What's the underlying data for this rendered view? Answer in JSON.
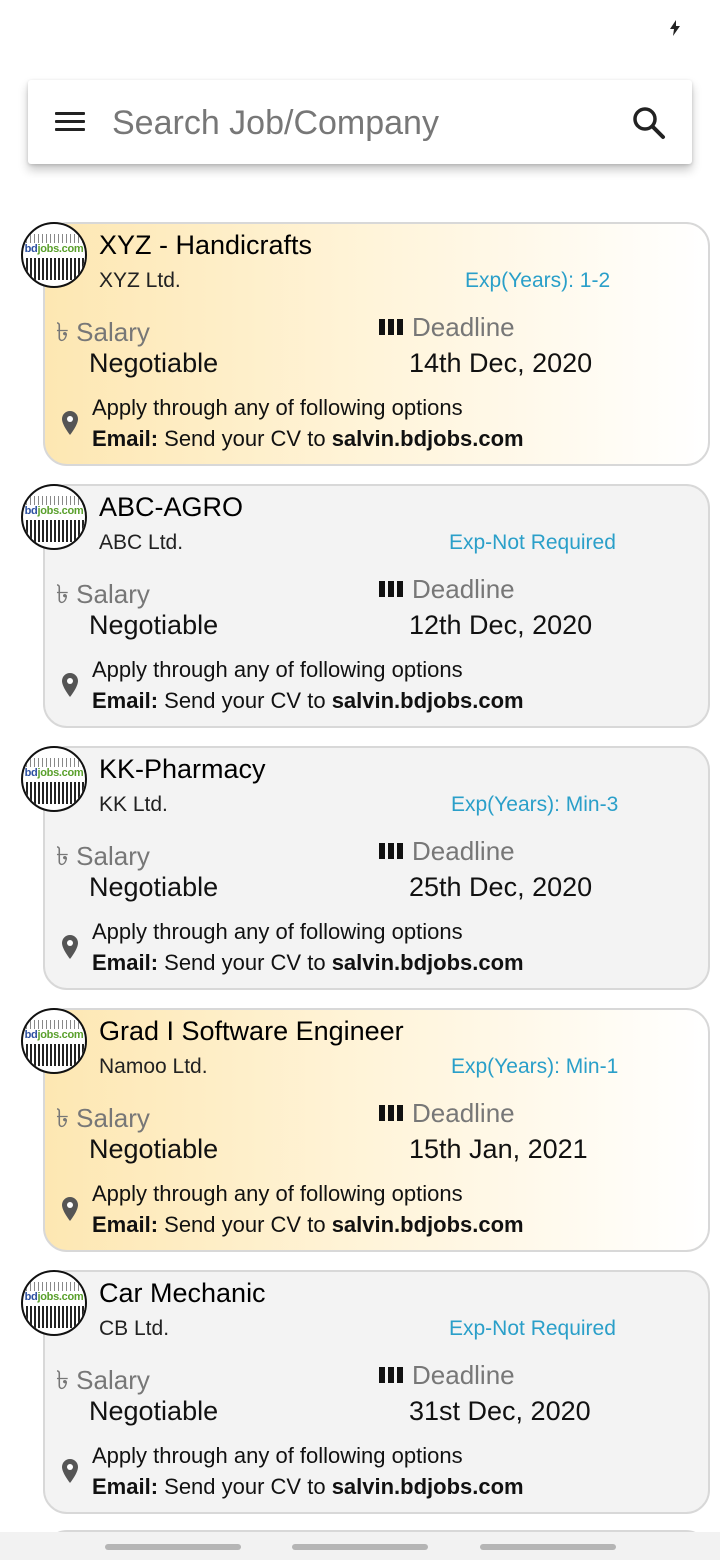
{
  "status_bar": {
    "icon": "bolt-icon"
  },
  "search": {
    "placeholder": "Search Job/Company",
    "menu_icon": "menu-icon",
    "search_icon": "search-icon"
  },
  "colors": {
    "highlight_start": "#fde7b2",
    "card_bg": "#f3f3f3",
    "exp_text": "#2a9fc9",
    "label_text": "#777777"
  },
  "common": {
    "salary_label": "৳ Salary",
    "deadline_label": "Deadline",
    "apply_text": "Apply through any of following options",
    "email_label": "Email:",
    "email_text": " Send your CV to ",
    "email_address": "salvin.bdjobs.com",
    "logo_text_a": "bd",
    "logo_text_b": "jobs.com"
  },
  "jobs": [
    {
      "title": "XYZ - Handicrafts",
      "company": "XYZ Ltd.",
      "experience": "Exp(Years): 1-2",
      "salary": "Negotiable",
      "deadline": "14th Dec, 2020",
      "highlighted": true
    },
    {
      "title": "ABC-AGRO",
      "company": "ABC Ltd.",
      "experience": "Exp-Not Required",
      "salary": "Negotiable",
      "deadline": "12th Dec, 2020",
      "highlighted": false
    },
    {
      "title": "KK-Pharmacy",
      "company": "KK Ltd.",
      "experience": "Exp(Years): Min-3",
      "salary": "Negotiable",
      "deadline": "25th Dec, 2020",
      "highlighted": false
    },
    {
      "title": "Grad I Software Engineer",
      "company": "Namoo Ltd.",
      "experience": "Exp(Years): Min-1",
      "salary": "Negotiable",
      "deadline": "15th Jan, 2021",
      "highlighted": true
    },
    {
      "title": "Car Mechanic",
      "company": "CB Ltd.",
      "experience": "Exp-Not Required",
      "salary": "Negotiable",
      "deadline": "31st Dec, 2020",
      "highlighted": false
    }
  ]
}
